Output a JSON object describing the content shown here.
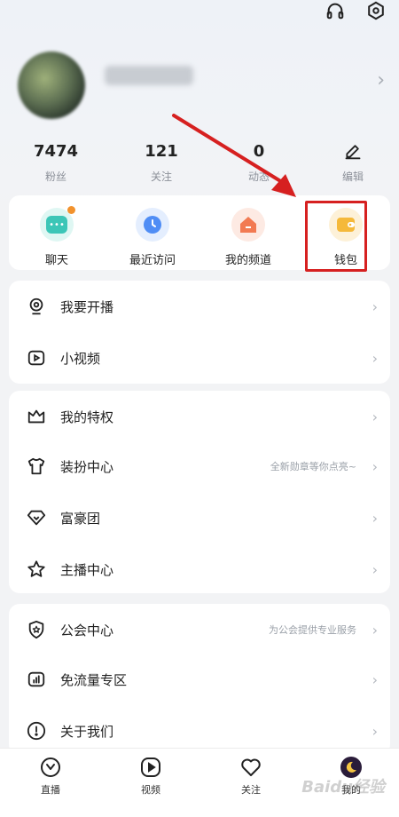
{
  "stats": [
    {
      "value": "7474",
      "label": "粉丝"
    },
    {
      "value": "121",
      "label": "关注"
    },
    {
      "value": "0",
      "label": "动态"
    },
    {
      "label": "编辑"
    }
  ],
  "quick_actions": [
    {
      "label": "聊天"
    },
    {
      "label": "最近访问"
    },
    {
      "label": "我的频道"
    },
    {
      "label": "钱包"
    }
  ],
  "group1": [
    {
      "label": "我要开播"
    },
    {
      "label": "小视频"
    }
  ],
  "group2": [
    {
      "label": "我的特权",
      "sub": ""
    },
    {
      "label": "装扮中心",
      "sub": "全新勋章等你点亮~"
    },
    {
      "label": "富豪团",
      "sub": ""
    },
    {
      "label": "主播中心",
      "sub": ""
    }
  ],
  "group3": [
    {
      "label": "公会中心",
      "sub": "为公会提供专业服务"
    },
    {
      "label": "免流量专区",
      "sub": ""
    },
    {
      "label": "关于我们",
      "sub": ""
    }
  ],
  "tabs": [
    {
      "label": "直播"
    },
    {
      "label": "视频"
    },
    {
      "label": "关注"
    },
    {
      "label": "我的"
    }
  ],
  "watermark": "Baidu经验",
  "colors": {
    "annotation_red": "#d62020",
    "chat": "#3cc6b7",
    "recent": "#4f8df5",
    "channel": "#f27a52",
    "wallet": "#f5b93a"
  }
}
